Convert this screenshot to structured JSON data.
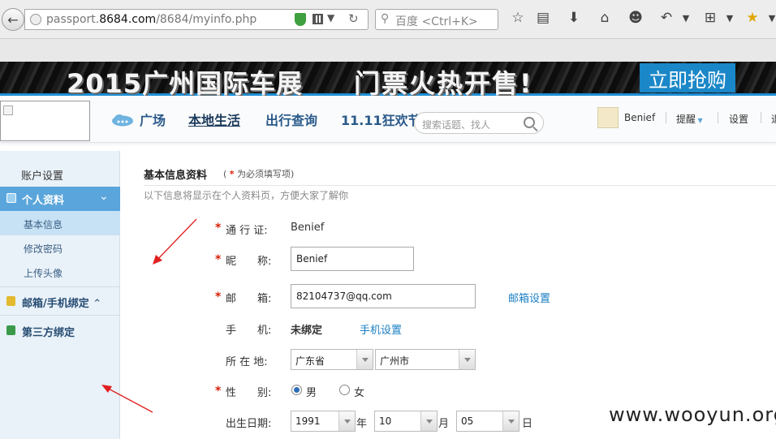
{
  "browser": {
    "url_prefix": "passport.",
    "url_domain": "8684.com",
    "url_path": "/8684/myinfo.php",
    "search_placeholder": "百度 <Ctrl+K>"
  },
  "banner": {
    "text1": "2015广州国际车展",
    "text2": "门票火热开售!",
    "button": "立即抢购"
  },
  "site_nav": {
    "links": [
      "广场",
      "本地生活",
      "出行查询",
      "11.11狂欢节"
    ],
    "search_placeholder": "搜索话题、找人",
    "user_name": "Benief",
    "remind": "提醒",
    "settings": "设置",
    "more": "退"
  },
  "sidebar": {
    "title": "账户设置",
    "personal": "个人资料",
    "items": [
      "基本信息",
      "修改密码",
      "上传头像"
    ],
    "mail_phone": "邮箱/手机绑定",
    "third_party": "第三方绑定"
  },
  "main": {
    "title": "基本信息资料",
    "note_open": "(",
    "note_star": "*",
    "note_text": "为必须填写项)",
    "desc": "以下信息将显示在个人资料页，方便大家了解你",
    "fields": {
      "passport_label": "通 行 证:",
      "passport_value": "Benief",
      "nickname_label": "昵　　称:",
      "nickname_value": "Benief",
      "email_label": "邮　　箱:",
      "email_value": "82104737@qq.com",
      "email_link": "邮箱设置",
      "phone_label": "手　　机:",
      "phone_value": "未绑定",
      "phone_link": "手机设置",
      "location_label": "所 在 地:",
      "province": "广东省",
      "city": "广州市",
      "gender_label": "性　　别:",
      "gender_male": "男",
      "gender_female": "女",
      "birthday_label": "出生日期:",
      "year": "1991",
      "year_unit": "年",
      "month": "10",
      "month_unit": "月",
      "day": "05",
      "day_unit": "日"
    },
    "star": "*"
  },
  "watermark": "www.wooyun.org",
  "colors": {
    "accent": "#5aa5db",
    "link": "#1b7fc4",
    "required": "#d81e06",
    "arrow": "#e02020"
  }
}
